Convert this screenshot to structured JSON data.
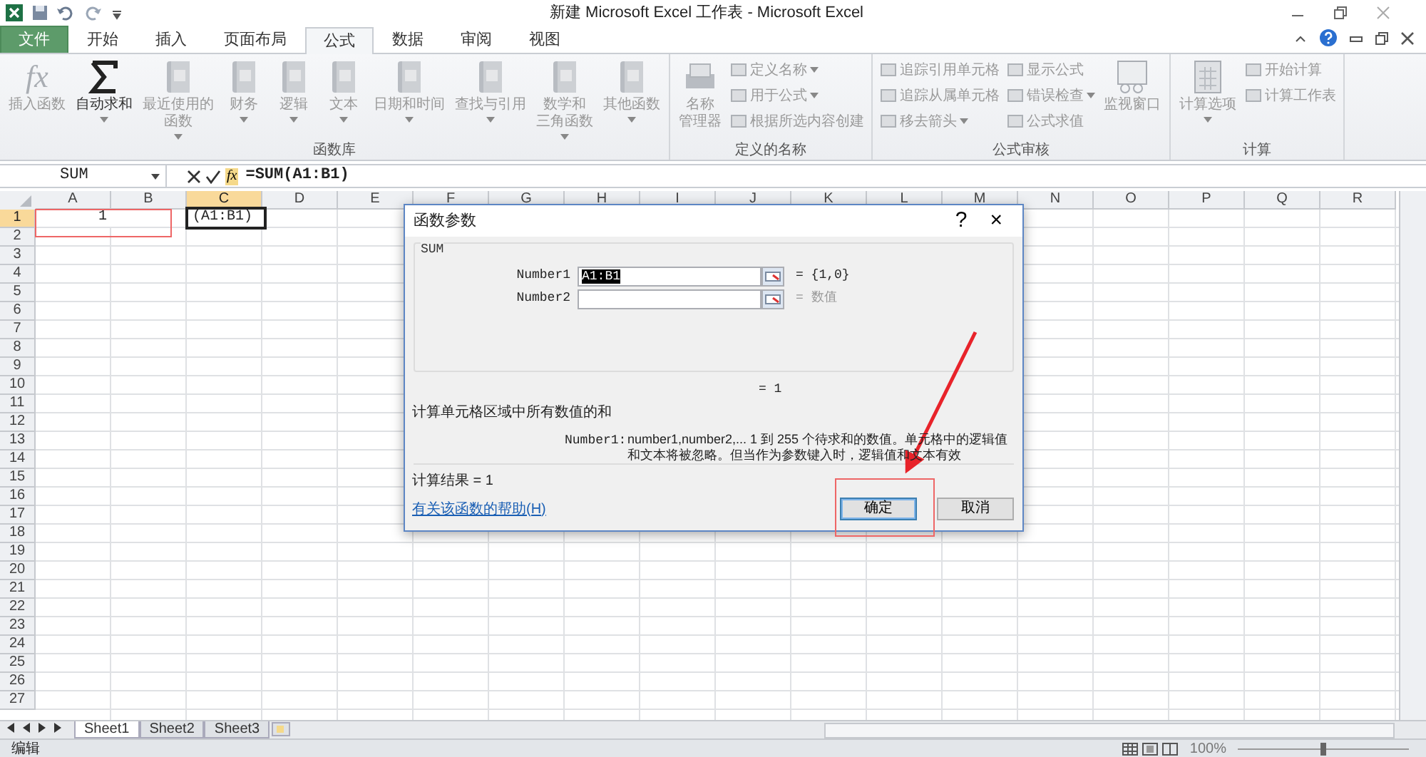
{
  "window": {
    "title": "新建 Microsoft Excel 工作表 - Microsoft Excel"
  },
  "tabs": [
    {
      "label": "文件",
      "kind": "file",
      "selected": false
    },
    {
      "label": "开始",
      "kind": "tab",
      "selected": false
    },
    {
      "label": "插入",
      "kind": "tab",
      "selected": false
    },
    {
      "label": "页面布局",
      "kind": "tab",
      "selected": false
    },
    {
      "label": "公式",
      "kind": "tab",
      "selected": true
    },
    {
      "label": "数据",
      "kind": "tab",
      "selected": false
    },
    {
      "label": "审阅",
      "kind": "tab",
      "selected": false
    },
    {
      "label": "视图",
      "kind": "tab",
      "selected": false
    }
  ],
  "ribbon": {
    "groups": [
      {
        "label": "函数库",
        "items": [
          {
            "kind": "large",
            "glyph": "fx",
            "lines": [
              "插入函数"
            ],
            "dropdown": false,
            "disabled": true
          },
          {
            "kind": "large",
            "lines": [
              "自动求和"
            ],
            "dropdown": true,
            "disabled": false
          },
          {
            "kind": "large",
            "lines": [
              "最近使用的",
              "函数"
            ],
            "dropdown": true,
            "disabled": true
          },
          {
            "kind": "large",
            "lines": [
              "财务"
            ],
            "dropdown": true,
            "disabled": true
          },
          {
            "kind": "large",
            "lines": [
              "逻辑"
            ],
            "dropdown": true,
            "disabled": true
          },
          {
            "kind": "large",
            "lines": [
              "文本"
            ],
            "dropdown": true,
            "disabled": true
          },
          {
            "kind": "large",
            "lines": [
              "日期和时间"
            ],
            "dropdown": true,
            "disabled": true
          },
          {
            "kind": "large",
            "lines": [
              "查找与引用"
            ],
            "dropdown": true,
            "disabled": true
          },
          {
            "kind": "large",
            "lines": [
              "数学和",
              "三角函数"
            ],
            "dropdown": true,
            "disabled": true
          },
          {
            "kind": "large",
            "lines": [
              "其他函数"
            ],
            "dropdown": true,
            "disabled": true
          }
        ]
      },
      {
        "label": "定义的名称",
        "items": [
          {
            "kind": "large",
            "lines": [
              "名称",
              "管理器"
            ],
            "dropdown": false,
            "disabled": true
          },
          {
            "kind": "small",
            "lines": [
              "定义名称"
            ],
            "dropdown": true,
            "disabled": true
          },
          {
            "kind": "small",
            "lines": [
              "用于公式"
            ],
            "dropdown": true,
            "disabled": true
          },
          {
            "kind": "small",
            "lines": [
              "根据所选内容创建"
            ],
            "dropdown": false,
            "disabled": true
          }
        ]
      },
      {
        "label": "公式审核",
        "items": [
          {
            "kind": "small",
            "lines": [
              "追踪引用单元格"
            ],
            "dropdown": false,
            "disabled": true
          },
          {
            "kind": "small",
            "lines": [
              "追踪从属单元格"
            ],
            "dropdown": false,
            "disabled": true
          },
          {
            "kind": "small",
            "lines": [
              "移去箭头"
            ],
            "dropdown": true,
            "disabled": true
          },
          {
            "kind": "small",
            "lines": [
              "显示公式"
            ],
            "dropdown": false,
            "disabled": true
          },
          {
            "kind": "small",
            "lines": [
              "错误检查"
            ],
            "dropdown": true,
            "disabled": true
          },
          {
            "kind": "small",
            "lines": [
              "公式求值"
            ],
            "dropdown": false,
            "disabled": true
          },
          {
            "kind": "large",
            "lines": [
              "监视窗口"
            ],
            "dropdown": false,
            "disabled": true
          }
        ]
      },
      {
        "label": "计算",
        "items": [
          {
            "kind": "large",
            "lines": [
              "计算选项"
            ],
            "dropdown": true,
            "disabled": true
          },
          {
            "kind": "small",
            "lines": [
              "开始计算"
            ],
            "dropdown": false,
            "disabled": true
          },
          {
            "kind": "small",
            "lines": [
              "计算工作表"
            ],
            "dropdown": false,
            "disabled": true
          }
        ]
      }
    ]
  },
  "formula_bar": {
    "name_box": "SUM",
    "fx_button": "fx",
    "formula": "=SUM(A1:B1)"
  },
  "sheet": {
    "columns": [
      {
        "label": "A",
        "selected": false
      },
      {
        "label": "B",
        "selected": false
      },
      {
        "label": "C",
        "selected": true
      },
      {
        "label": "D",
        "selected": false
      },
      {
        "label": "E",
        "selected": false
      },
      {
        "label": "F",
        "selected": false
      },
      {
        "label": "G",
        "selected": false
      },
      {
        "label": "H",
        "selected": false
      },
      {
        "label": "I",
        "selected": false
      },
      {
        "label": "J",
        "selected": false
      },
      {
        "label": "K",
        "selected": false
      },
      {
        "label": "L",
        "selected": false
      },
      {
        "label": "M",
        "selected": false
      },
      {
        "label": "N",
        "selected": false
      },
      {
        "label": "O",
        "selected": false
      },
      {
        "label": "P",
        "selected": false
      },
      {
        "label": "Q",
        "selected": false
      },
      {
        "label": "R",
        "selected": false
      }
    ],
    "rows": [
      {
        "label": "1",
        "selected": true,
        "cells": [
          "1",
          "",
          "(A1:B1)"
        ]
      },
      {
        "label": "2",
        "selected": false
      },
      {
        "label": "3",
        "selected": false
      },
      {
        "label": "4",
        "selected": false
      },
      {
        "label": "5",
        "selected": false
      },
      {
        "label": "6",
        "selected": false
      },
      {
        "label": "7",
        "selected": false
      },
      {
        "label": "8",
        "selected": false
      },
      {
        "label": "9",
        "selected": false
      },
      {
        "label": "10",
        "selected": false
      },
      {
        "label": "11",
        "selected": false
      },
      {
        "label": "12",
        "selected": false
      },
      {
        "label": "13",
        "selected": false
      },
      {
        "label": "14",
        "selected": false
      },
      {
        "label": "15",
        "selected": false
      },
      {
        "label": "16",
        "selected": false
      },
      {
        "label": "17",
        "selected": false
      },
      {
        "label": "18",
        "selected": false
      },
      {
        "label": "19",
        "selected": false
      },
      {
        "label": "20",
        "selected": false
      },
      {
        "label": "21",
        "selected": false
      },
      {
        "label": "22",
        "selected": false
      },
      {
        "label": "23",
        "selected": false
      },
      {
        "label": "24",
        "selected": false
      },
      {
        "label": "25",
        "selected": false
      },
      {
        "label": "26",
        "selected": false
      },
      {
        "label": "27",
        "selected": false
      }
    ]
  },
  "sheet_tabs": [
    {
      "label": "Sheet1",
      "selected": true
    },
    {
      "label": "Sheet2",
      "selected": false
    },
    {
      "label": "Sheet3",
      "selected": false
    }
  ],
  "status_bar": {
    "mode": "编辑",
    "zoom": "100%",
    "zoom_slider": {
      "level": 0.5
    }
  },
  "dialog": {
    "title": "函数参数",
    "help": "?",
    "close": "×",
    "function_name": "SUM",
    "arguments": [
      {
        "label": "Number1",
        "value": "A1:B1",
        "highlighted": true,
        "result": "= {1,0}",
        "muted": false
      },
      {
        "label": "Number2",
        "highlighted": false,
        "result": "= 数值",
        "muted": true
      }
    ],
    "formula_result": "= 1",
    "description": "计算单元格区域中所有数值的和",
    "argument_help": {
      "label": "Number1:",
      "text": "number1,number2,...   1 到 255 个待求和的数值。单元格中的逻辑值和文本将被忽略。但当作为参数键入时，逻辑值和文本有效"
    },
    "calc_result": "计算结果 = 1",
    "help_link": "有关该函数的帮助(H)",
    "buttons": [
      {
        "label": "确定",
        "selected": true
      },
      {
        "label": "取消",
        "selected": false
      }
    ]
  }
}
